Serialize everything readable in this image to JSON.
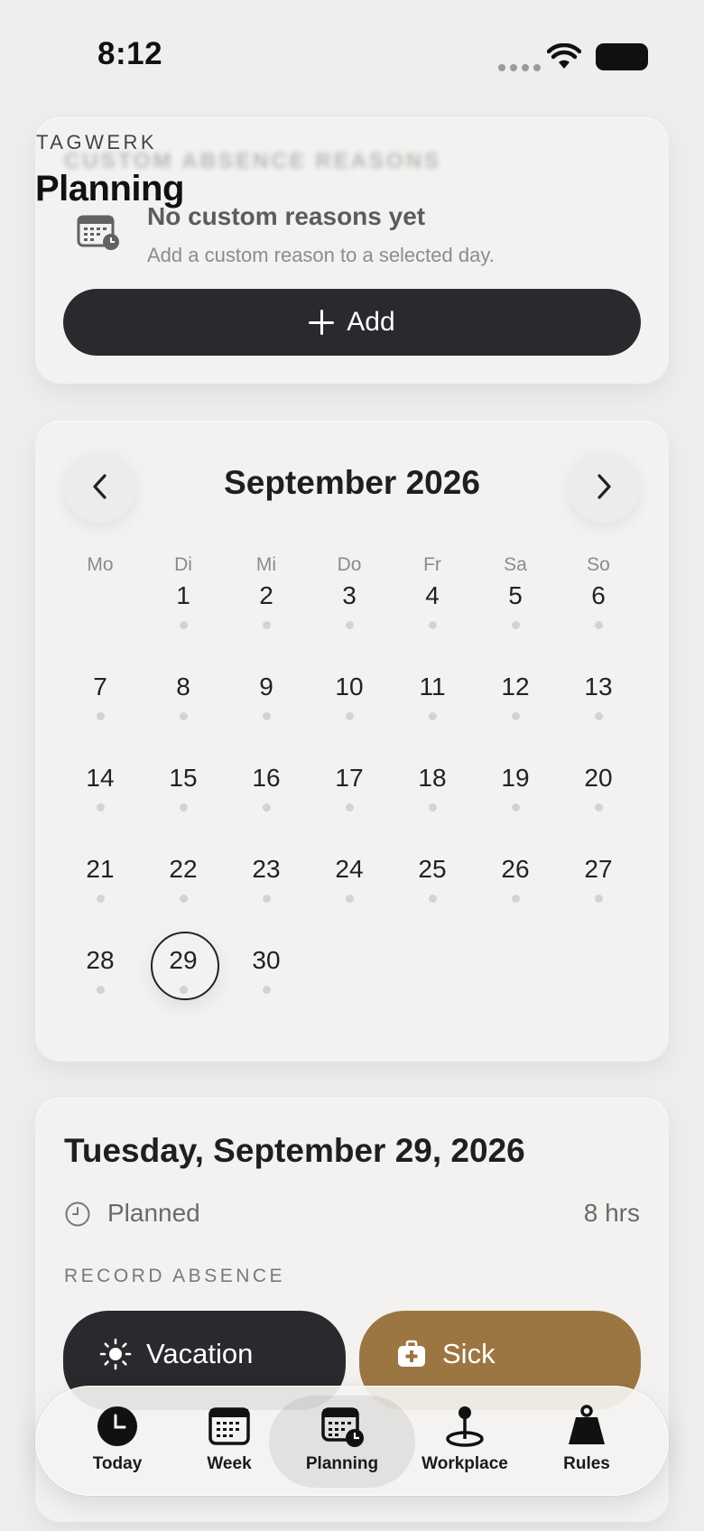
{
  "status_bar": {
    "time": "8:12"
  },
  "header": {
    "brand": "TAGWERK",
    "title": "Planning"
  },
  "custom_reasons": {
    "heading": "CUSTOM ABSENCE REASONS",
    "empty_title": "No custom reasons yet",
    "empty_subtitle": "Add a custom reason to a selected day.",
    "add_label": "Add"
  },
  "calendar": {
    "month_title": "September 2026",
    "weekdays": [
      "Mo",
      "Di",
      "Mi",
      "Do",
      "Fr",
      "Sa",
      "So"
    ],
    "first_weekday_index": 1,
    "days_in_month": 30,
    "selected_day": 29
  },
  "day_detail": {
    "date_title": "Tuesday, September 29, 2026",
    "planned_label": "Planned",
    "planned_hours": "8 hrs",
    "record_absence_label": "RECORD ABSENCE",
    "vacation_label": "Vacation",
    "sick_label": "Sick"
  },
  "tab_bar": {
    "active": "Planning",
    "tabs": [
      {
        "label": "Today",
        "icon": "clock-icon"
      },
      {
        "label": "Week",
        "icon": "calendar-grid-icon"
      },
      {
        "label": "Planning",
        "icon": "calendar-clock-icon"
      },
      {
        "label": "Workplace",
        "icon": "location-pin-icon"
      },
      {
        "label": "Rules",
        "icon": "weight-icon"
      }
    ]
  },
  "colors": {
    "background": "#efeeec",
    "dark_button": "#2a292d",
    "sick_button": "#9c7642"
  }
}
